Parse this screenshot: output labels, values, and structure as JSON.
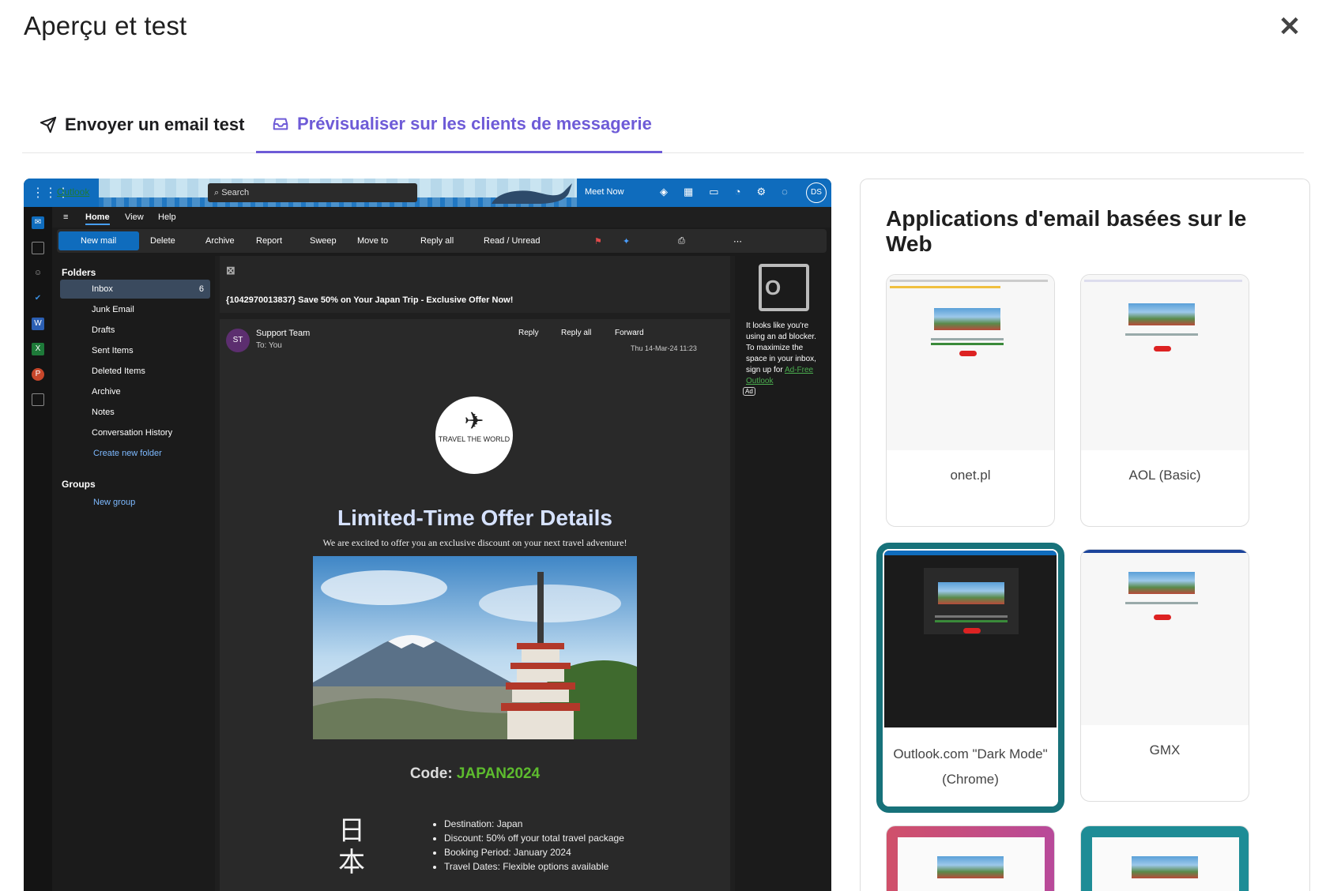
{
  "modal": {
    "title": "Aperçu et test",
    "close_label": "✕"
  },
  "tabs": [
    {
      "label": "Envoyer un email test",
      "icon": "send-icon",
      "active": false
    },
    {
      "label": "Prévisualiser sur les clients de messagerie",
      "icon": "inbox-icon",
      "active": true
    }
  ],
  "outlook": {
    "brand": "Outlook",
    "search_placeholder": "Search",
    "meet_now": "Meet Now",
    "avatar": "DS",
    "menu": {
      "home": "Home",
      "view": "View",
      "help": "Help"
    },
    "ribbon": {
      "new_mail": "New mail",
      "delete": "Delete",
      "archive": "Archive",
      "report": "Report",
      "sweep": "Sweep",
      "move_to": "Move to",
      "reply_all": "Reply all",
      "read_unread": "Read / Unread"
    },
    "folders_header": "Folders",
    "folders": [
      {
        "label": "Inbox",
        "count": "6"
      },
      {
        "label": "Junk Email"
      },
      {
        "label": "Drafts"
      },
      {
        "label": "Sent Items"
      },
      {
        "label": "Deleted Items"
      },
      {
        "label": "Archive"
      },
      {
        "label": "Notes"
      },
      {
        "label": "Conversation History"
      }
    ],
    "create_folder": "Create new folder",
    "groups_header": "Groups",
    "new_group": "New group",
    "subject": "{1042970013837} Save 50% on Your Japan Trip - Exclusive Offer Now!",
    "sender": "Support Team",
    "sender_initials": "ST",
    "to_label": "To:",
    "to_value": "You",
    "reply": "Reply",
    "reply_all": "Reply all",
    "forward": "Forward",
    "date": "Thu 14-Mar-24 11:23",
    "logo_text": "TRAVEL THE WORLD",
    "offer_title": "Limited-Time Offer Details",
    "offer_sub": "We are excited to offer you an exclusive discount on your next travel adventure!",
    "code_label": "Code:",
    "code_value": "JAPAN2024",
    "kanji": "日本",
    "bullets": [
      "Destination: Japan",
      "Discount: 50% off your total travel package",
      "Booking Period: January 2024",
      "Travel Dates: Flexible options available"
    ],
    "ad_text": "It looks like you're using an ad blocker. To maximize the space in your inbox, sign up for",
    "ad_link": "Ad-Free Outlook",
    "ad_badge": "Ad"
  },
  "panel": {
    "title": "Applications d'email basées sur le Web",
    "clients": [
      {
        "label": "onet.pl",
        "selected": false
      },
      {
        "label": "AOL (Basic)",
        "selected": false
      },
      {
        "label": "Outlook.com \"Dark Mode\" (Chrome)",
        "selected": true
      },
      {
        "label": "GMX",
        "selected": false
      }
    ]
  },
  "colors": {
    "accent": "#6e5bd7",
    "selected_border": "#17727a",
    "code_green": "#5dbb2e"
  }
}
